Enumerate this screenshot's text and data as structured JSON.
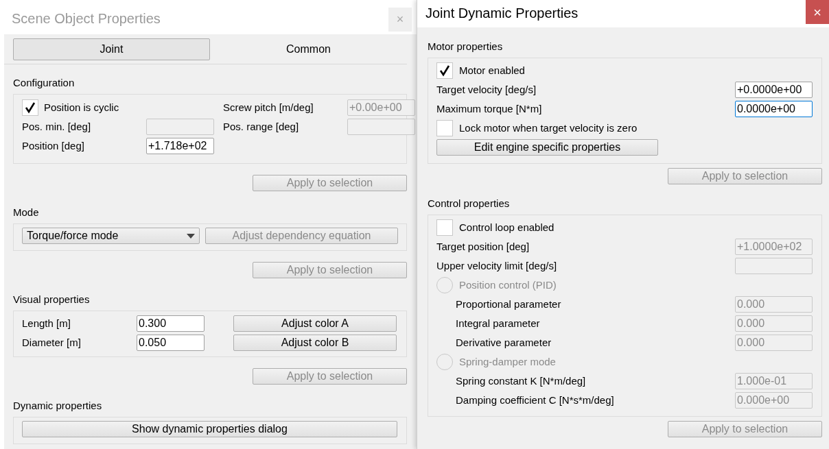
{
  "left_window": {
    "title": "Scene Object Properties",
    "active": false,
    "close": "×",
    "tabs": [
      {
        "label": "Joint",
        "selected": true
      },
      {
        "label": "Common",
        "selected": false
      }
    ],
    "configuration": {
      "heading": "Configuration",
      "items": [
        {
          "kind": "checkbox",
          "label": "Position is cyclic",
          "checked": true
        },
        {
          "kind": "field",
          "label": "Screw pitch [m/deg]",
          "value": "+0.00e+00",
          "disabled": true
        },
        {
          "kind": "field",
          "label": "Pos. min. [deg]",
          "disabled": true
        },
        {
          "kind": "field",
          "label": "Pos. range [deg]",
          "disabled": true
        },
        {
          "kind": "field",
          "label": "Position [deg]",
          "value": "+1.718e+02",
          "disabled": false
        }
      ],
      "apply": {
        "label": "Apply to selection",
        "disabled": true
      }
    },
    "mode": {
      "heading": "Mode",
      "dropdown": "Torque/force mode",
      "button": {
        "label": "Adjust dependency equation",
        "disabled": true
      },
      "apply": {
        "label": "Apply to selection",
        "disabled": true
      }
    },
    "visual": {
      "heading": "Visual properties",
      "rows": [
        {
          "label": "Length [m]",
          "value": "0.300",
          "button": "Adjust color A"
        },
        {
          "label": "Diameter [m]",
          "value": "0.050",
          "button": "Adjust color B"
        }
      ],
      "apply": {
        "label": "Apply to selection",
        "disabled": true
      }
    },
    "dynamic": {
      "heading": "Dynamic properties",
      "button": "Show dynamic properties dialog"
    }
  },
  "right_window": {
    "title": "Joint Dynamic Properties",
    "active": true,
    "close": "×",
    "sections": [
      {
        "heading": "Motor properties",
        "items": [
          {
            "kind": "checkbox",
            "label": "Motor enabled",
            "checked": true
          },
          {
            "kind": "field",
            "label": "Target velocity [deg/s]",
            "value": "+0.0000e+00",
            "disabled": false,
            "focused": false
          },
          {
            "kind": "field",
            "label": "Maximum torque [N*m]",
            "value": "0.0000e+00",
            "disabled": false,
            "focused": true
          },
          {
            "kind": "checkbox",
            "label": "Lock motor when target velocity is zero",
            "checked": false
          },
          {
            "kind": "button",
            "label": "Edit engine specific properties"
          }
        ],
        "apply": {
          "label": "Apply to selection",
          "disabled": true
        }
      },
      {
        "heading": "Control properties",
        "items": [
          {
            "kind": "checkbox",
            "label": "Control loop enabled",
            "checked": false
          },
          {
            "kind": "field",
            "label": "Target position [deg]",
            "value": "+1.0000e+02",
            "disabled": true,
            "focused": false
          },
          {
            "kind": "field",
            "label": "Upper velocity limit [deg/s]",
            "disabled": true,
            "focused": false
          },
          {
            "kind": "radio",
            "label": "Position control (PID)",
            "selected": false,
            "disabled": true,
            "children": [
              {
                "kind": "field",
                "label": "Proportional parameter",
                "value": "0.000",
                "disabled": true,
                "focused": false
              },
              {
                "kind": "field",
                "label": "Integral parameter",
                "value": "0.000",
                "disabled": true,
                "focused": false
              },
              {
                "kind": "field",
                "label": "Derivative parameter",
                "value": "0.000",
                "disabled": true,
                "focused": false
              }
            ]
          },
          {
            "kind": "radio",
            "label": "Spring-damper mode",
            "selected": false,
            "disabled": true,
            "children": [
              {
                "kind": "field",
                "label": "Spring constant K [N*m/deg]",
                "value": "1.000e-01",
                "disabled": true,
                "focused": false
              },
              {
                "kind": "field",
                "label": "Damping coefficient C [N*s*m/deg]",
                "value": "0.000e+00",
                "disabled": true,
                "focused": false
              }
            ]
          }
        ],
        "apply": {
          "label": "Apply to selection",
          "disabled": true
        }
      }
    ]
  }
}
